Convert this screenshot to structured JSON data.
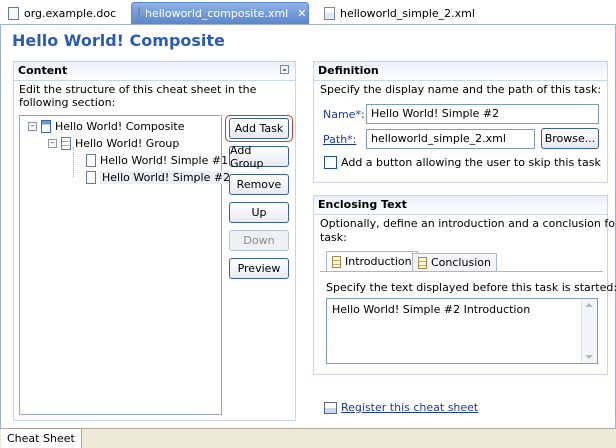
{
  "tabs": [
    {
      "label": "org.example.doc"
    },
    {
      "label": "helloworld_composite.xml"
    },
    {
      "label": "helloworld_simple_2.xml"
    }
  ],
  "page_title": "Hello World! Composite",
  "content": {
    "header": "Content",
    "description": "Edit the structure of this cheat sheet in the following section:",
    "tree": [
      {
        "label": "Hello World! Composite"
      },
      {
        "label": "Hello World! Group"
      },
      {
        "label": "Hello World! Simple #1"
      },
      {
        "label": "Hello World! Simple #2"
      }
    ],
    "buttons": {
      "add_task": "Add Task",
      "add_group": "Add Group",
      "remove": "Remove",
      "up": "Up",
      "down": "Down",
      "preview": "Preview"
    }
  },
  "definition": {
    "header": "Definition",
    "description": "Specify the display name and the path of this task:",
    "name_label": "Name*:",
    "name_value": "Hello World! Simple #2",
    "path_label": "Path*:",
    "path_value": "helloworld_simple_2.xml",
    "browse_label": "Browse...",
    "skip_label": "Add a button allowing the user to skip this task"
  },
  "enclosing": {
    "header": "Enclosing Text",
    "description_1": "Optionally, define an introduction and a conclusion for this",
    "description_2": "task:",
    "tab_intro": "Introduction",
    "tab_conclusion": "Conclusion",
    "intro_prompt": "Specify the text displayed before this task is started:",
    "intro_text": "Hello World! Simple #2 Introduction"
  },
  "register_link": "Register this cheat sheet",
  "bottom_tab": "Cheat Sheet",
  "colors": {
    "title": "#2a5db0",
    "active_tab": "#5a86cc",
    "link": "#1b3a9a"
  }
}
